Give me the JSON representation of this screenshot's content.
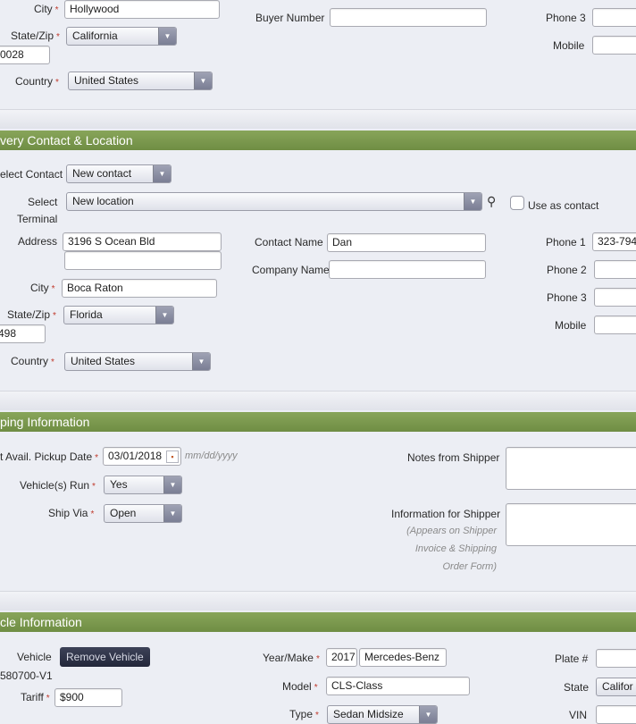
{
  "section_top": {
    "city_label": "City",
    "city_value": "Hollywood",
    "buyer_number_label": "Buyer Number",
    "buyer_number_value": "",
    "phone3_label": "Phone 3",
    "state_zip_label": "State/Zip",
    "state_value": "California",
    "mobile_label": "Mobile",
    "zip_value": "0028",
    "country_label": "Country",
    "country_value": "United States"
  },
  "delivery": {
    "header": "very Contact & Location",
    "select_contact_label": "elect Contact",
    "select_contact_value": "New contact",
    "select_terminal_label_1": "Select",
    "select_terminal_label_2": "Terminal",
    "select_terminal_value": "New location",
    "use_as_contact_label": "Use as contact",
    "address_label": "Address",
    "address_line1": "3196 S Ocean Bld",
    "address_line2": "",
    "contact_name_label": "Contact Name",
    "contact_name_value": "Dan",
    "phone1_label": "Phone 1",
    "phone1_value": "323-794-",
    "company_name_label": "Company Name",
    "company_name_value": "",
    "phone2_label": "Phone 2",
    "city_label": "City",
    "city_value": "Boca Raton",
    "phone3_label": "Phone 3",
    "state_zip_label": "State/Zip",
    "state_value": "Florida",
    "mobile_label": "Mobile",
    "zip_value": "498",
    "country_label": "Country",
    "country_value": "United States"
  },
  "shipping": {
    "header": "ping Information",
    "pickup_label": "t Avail. Pickup Date",
    "pickup_value": "03/01/2018",
    "pickup_hint": "mm/dd/yyyy",
    "notes_label": "Notes from Shipper",
    "vehicles_run_label": "Vehicle(s) Run",
    "vehicles_run_value": "Yes",
    "ship_via_label": "Ship Via",
    "ship_via_value": "Open",
    "info_label": "Information for Shipper",
    "info_note_1": "(Appears on Shipper",
    "info_note_2": "Invoice & Shipping",
    "info_note_3": "Order Form)"
  },
  "vehicle": {
    "header": "cle Information",
    "vehicle_label": "Vehicle",
    "remove_button": "Remove Vehicle",
    "vehicle_id": "580700-V1",
    "year_make_label": "Year/Make",
    "year_value": "2017",
    "make_value": "Mercedes-Benz",
    "plate_label": "Plate #",
    "tariff_label": "Tariff",
    "tariff_value": "$900",
    "model_label": "Model",
    "model_value": "CLS-Class",
    "state_label": "State",
    "state_value": "Califor",
    "type_label": "Type",
    "type_value": "Sedan Midsize",
    "vin_label": "VIN"
  },
  "icons": {
    "dropdown": "chevron-down-icon",
    "search": "search-icon",
    "calendar": "calendar-icon"
  },
  "colors": {
    "section_header": "#7a9a4e",
    "background": "#eceef4",
    "required": "#c0392b"
  }
}
